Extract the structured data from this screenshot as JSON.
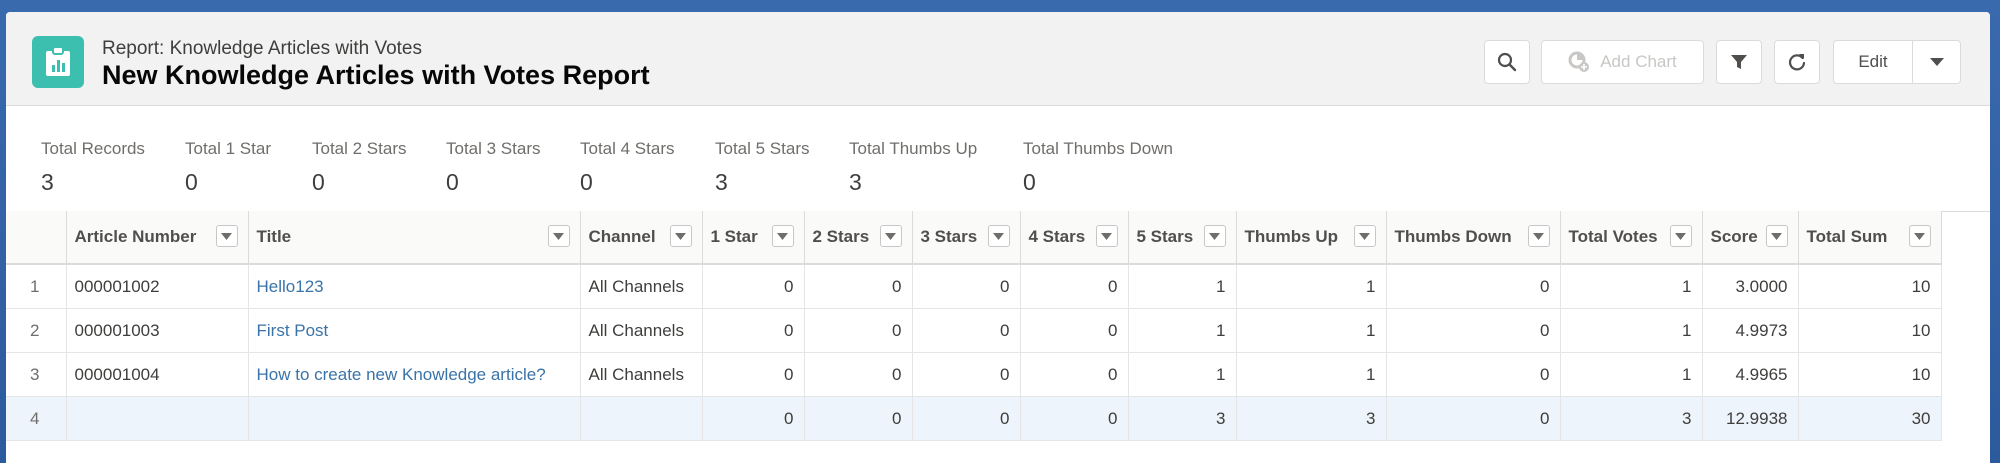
{
  "header": {
    "subtitle": "Report: Knowledge Articles with Votes",
    "title": "New Knowledge Articles with Votes Report"
  },
  "toolbar": {
    "add_chart_label": "Add Chart",
    "edit_label": "Edit"
  },
  "summary": [
    {
      "label": "Total Records",
      "value": "3"
    },
    {
      "label": "Total 1 Star",
      "value": "0"
    },
    {
      "label": "Total 2 Stars",
      "value": "0"
    },
    {
      "label": "Total 3 Stars",
      "value": "0"
    },
    {
      "label": "Total 4 Stars",
      "value": "0"
    },
    {
      "label": "Total 5 Stars",
      "value": "3"
    },
    {
      "label": "Total Thumbs Up",
      "value": "3"
    },
    {
      "label": "Total Thumbs Down",
      "value": "0"
    }
  ],
  "table": {
    "columns": [
      "Article Number",
      "Title",
      "Channel",
      "1 Star",
      "2 Stars",
      "3 Stars",
      "4 Stars",
      "5 Stars",
      "Thumbs Up",
      "Thumbs Down",
      "Total Votes",
      "Score",
      "Total Sum"
    ],
    "rows": [
      {
        "n": "1",
        "cells": [
          "000001002",
          "Hello123",
          "All Channels",
          "0",
          "0",
          "0",
          "0",
          "1",
          "1",
          "0",
          "1",
          "3.0000",
          "10"
        ]
      },
      {
        "n": "2",
        "cells": [
          "000001003",
          "First Post",
          "All Channels",
          "0",
          "0",
          "0",
          "0",
          "1",
          "1",
          "0",
          "1",
          "4.9973",
          "10"
        ]
      },
      {
        "n": "3",
        "cells": [
          "000001004",
          "How to create new Knowledge article?",
          "All Channels",
          "0",
          "0",
          "0",
          "0",
          "1",
          "1",
          "0",
          "1",
          "4.9965",
          "10"
        ]
      },
      {
        "n": "4",
        "cells": [
          "",
          "",
          "",
          "0",
          "0",
          "0",
          "0",
          "3",
          "3",
          "0",
          "3",
          "12.9938",
          "30"
        ]
      }
    ]
  },
  "colors": {
    "accent": "#3cbfae",
    "link": "#3a73a8",
    "total_row": "#eef4fb"
  }
}
